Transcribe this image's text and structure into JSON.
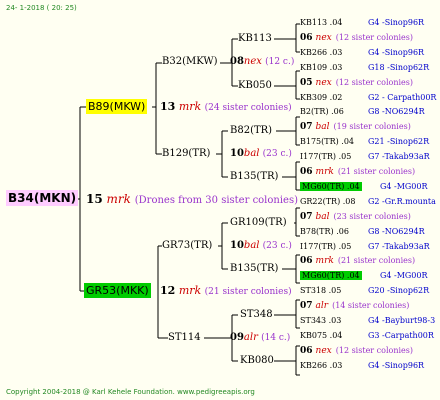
{
  "header": {
    "date": "24- 1-2018 ( 20: 25)"
  },
  "footer": {
    "text": "Copyright 2004-2018 @ Karl Kehele Foundation. www.pedigreeapis.org"
  },
  "root": {
    "id": "B34(MKN)",
    "num": "15",
    "code": "mrk",
    "note": "(Drones from 30 sister colonies)"
  },
  "l1a": {
    "id": "B89(MKW)",
    "num": "13",
    "code": "mrk",
    "note": "(24 sister colonies)"
  },
  "l1b": {
    "id": "GR53(MKK)",
    "num": "12",
    "code": "mrk",
    "note": "(21 sister colonies)"
  },
  "l2": {
    "a": {
      "id": "B32(MKW)",
      "num": "08",
      "code": "nex",
      "note": "(12 c.)"
    },
    "b": {
      "id": "B129(TR)",
      "num": "10",
      "code": "bal",
      "note": "(23 c.)"
    },
    "c": {
      "id": "GR73(TR)",
      "num": "10",
      "code": "bal",
      "note": "(23 c.)"
    },
    "d": {
      "id": "ST114",
      "num": "09",
      "code": "alr",
      "note": "(14 c.)"
    }
  },
  "l3": {
    "a1": "KB113",
    "a2": "KB050",
    "b1": "B82(TR)",
    "b2": "B135(TR)",
    "c1": "GR109(TR)",
    "c2": "B135(TR)",
    "d1": "ST348",
    "d2": "KB080"
  },
  "leaves": [
    {
      "id": "KB113 .04",
      "ref": "G4 -Sinop96R"
    },
    {
      "num": "06",
      "code": "nex",
      "note": "(12 sister colonies)"
    },
    {
      "id": "KB266 .03",
      "ref": "G4 -Sinop96R"
    },
    {
      "id": "KB109 .03",
      "ref": "G18 -Sinop62R"
    },
    {
      "num": "05",
      "code": "nex",
      "note": "(12 sister colonies)"
    },
    {
      "id": "KB309 .02",
      "ref": "G2 - Carpath00R"
    },
    {
      "id": "B2(TR) .06",
      "ref": "G8 -NO6294R"
    },
    {
      "num": "07",
      "code": "bal",
      "note": "(19 sister colonies)"
    },
    {
      "id": "B175(TR) .04",
      "ref": "G21 -Sinop62R"
    },
    {
      "id": "I177(TR) .05",
      "ref": "G7 -Takab93aR"
    },
    {
      "num": "06",
      "code": "mrk",
      "note": "(21 sister colonies)"
    },
    {
      "id": "MG60(TR) .04",
      "ref": "G4 -MG00R",
      "hl": true
    },
    {
      "id": "GR22(TR) .08",
      "ref": "G2 -Gr.R.mounta"
    },
    {
      "num": "07",
      "code": "bal",
      "note": "(23 sister colonies)"
    },
    {
      "id": "B78(TR) .06",
      "ref": "G8 -NO6294R"
    },
    {
      "id": "I177(TR) .05",
      "ref": "G7 -Takab93aR"
    },
    {
      "num": "06",
      "code": "mrk",
      "note": "(21 sister colonies)"
    },
    {
      "id": "MG60(TR) .04",
      "ref": "G4 -MG00R",
      "hl": true
    },
    {
      "id": "ST318 .05",
      "ref": "G20 -Sinop62R"
    },
    {
      "num": "07",
      "code": "alr",
      "note": "(14 sister colonies)"
    },
    {
      "id": "ST343 .03",
      "ref": "G4 -Bayburt98-3"
    },
    {
      "id": "KB075 .04",
      "ref": "G3 -Carpath00R"
    },
    {
      "num": "06",
      "code": "nex",
      "note": "(12 sister colonies)"
    },
    {
      "id": "KB266 .03",
      "ref": "G4 -Sinop96R"
    }
  ]
}
